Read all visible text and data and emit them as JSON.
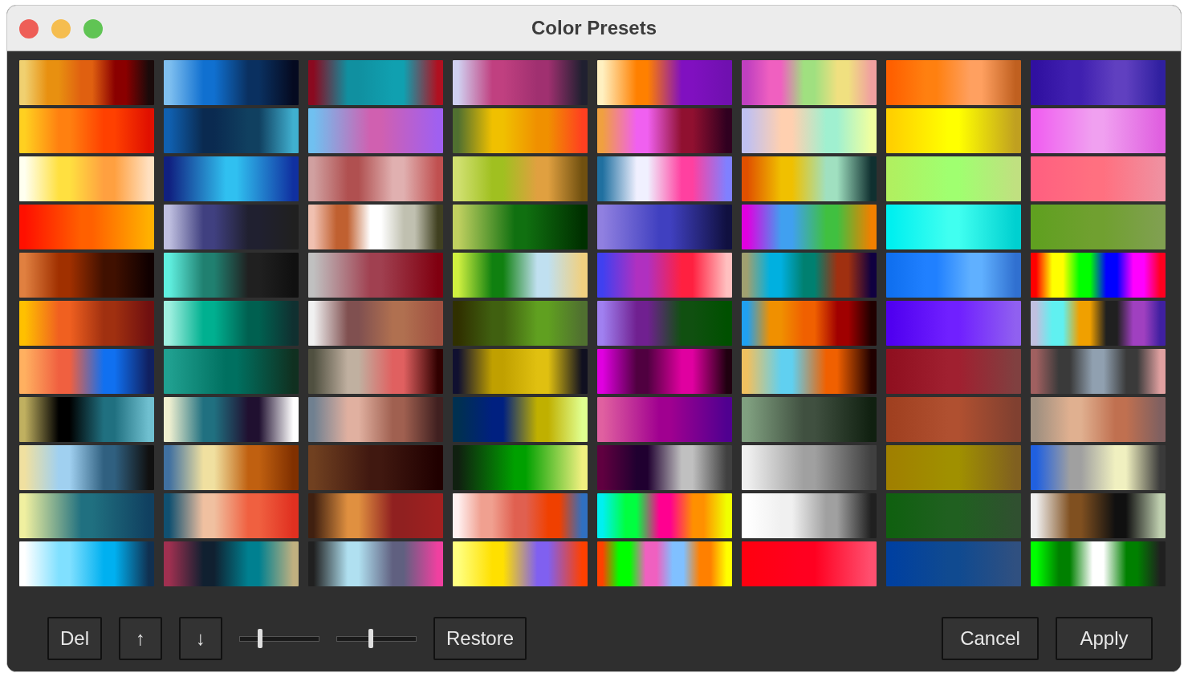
{
  "window": {
    "title": "Color Presets"
  },
  "swatches": [
    {
      "stops": [
        {
          "color": "#f0d070"
        },
        {
          "color": "#e89010"
        },
        {
          "color": "#e06010"
        },
        {
          "color": "#8a0000"
        },
        {
          "color": "#1a0a0a"
        }
      ]
    },
    {
      "stops": [
        {
          "color": "#80c0f0"
        },
        {
          "color": "#1070d0"
        },
        {
          "color": "#0a3060"
        },
        {
          "color": "#050a20"
        }
      ]
    },
    {
      "stops": [
        {
          "color": "#8a0a20"
        },
        {
          "color": "#1090a0"
        },
        {
          "color": "#10a0b0"
        },
        {
          "color": "#b01020"
        }
      ]
    },
    {
      "stops": [
        {
          "color": "#d0d0f0"
        },
        {
          "color": "#c04080"
        },
        {
          "color": "#a03070"
        },
        {
          "color": "#202030"
        }
      ]
    },
    {
      "stops": [
        {
          "color": "#fff0c0"
        },
        {
          "color": "#ff8000"
        },
        {
          "color": "#8010c0"
        },
        {
          "color": "#7010b0"
        }
      ]
    },
    {
      "stops": [
        {
          "color": "#c040c0"
        },
        {
          "color": "#f060c0"
        },
        {
          "color": "#a0e080"
        },
        {
          "color": "#f0e080"
        },
        {
          "color": "#f0a0a0"
        }
      ]
    },
    {
      "stops": [
        {
          "color": "#ff6000"
        },
        {
          "color": "#ff8010"
        },
        {
          "color": "#ffa060"
        },
        {
          "color": "#c06020"
        }
      ]
    },
    {
      "stops": [
        {
          "color": "#3010a0"
        },
        {
          "color": "#4020b0"
        },
        {
          "color": "#6040c0"
        },
        {
          "color": "#3020a0"
        }
      ]
    },
    {
      "stops": [
        {
          "color": "#ffd020"
        },
        {
          "color": "#ff8010"
        },
        {
          "color": "#ff4000"
        },
        {
          "color": "#e01000"
        }
      ]
    },
    {
      "stops": [
        {
          "color": "#1060b0"
        },
        {
          "color": "#0a2a50"
        },
        {
          "color": "#104060"
        },
        {
          "color": "#40b0d0"
        }
      ]
    },
    {
      "stops": [
        {
          "color": "#70c0f0"
        },
        {
          "color": "#d060b0"
        },
        {
          "color": "#a060f0"
        }
      ]
    },
    {
      "stops": [
        {
          "color": "#507030"
        },
        {
          "color": "#f0c000"
        },
        {
          "color": "#f09000"
        },
        {
          "color": "#ff4020"
        }
      ]
    },
    {
      "stops": [
        {
          "color": "#f0a040"
        },
        {
          "color": "#f060f0"
        },
        {
          "color": "#901030"
        },
        {
          "color": "#300020"
        }
      ]
    },
    {
      "stops": [
        {
          "color": "#c0c0f0"
        },
        {
          "color": "#ffd0b0"
        },
        {
          "color": "#a0f0d0"
        },
        {
          "color": "#f0ffa0"
        }
      ]
    },
    {
      "stops": [
        {
          "color": "#ffd000"
        },
        {
          "color": "#ffff00"
        },
        {
          "color": "#c0a020"
        }
      ]
    },
    {
      "stops": [
        {
          "color": "#f060f0"
        },
        {
          "color": "#f0a0f0"
        },
        {
          "color": "#e060e0"
        }
      ]
    },
    {
      "stops": [
        {
          "color": "#fffff0"
        },
        {
          "color": "#ffe040"
        },
        {
          "color": "#ffa040"
        },
        {
          "color": "#ffe0c0"
        }
      ]
    },
    {
      "stops": [
        {
          "color": "#102080"
        },
        {
          "color": "#30c0f0"
        },
        {
          "color": "#1030a0"
        }
      ]
    },
    {
      "stops": [
        {
          "color": "#d0a0a0"
        },
        {
          "color": "#b05050"
        },
        {
          "color": "#e0b0b0"
        },
        {
          "color": "#c05050"
        }
      ]
    },
    {
      "stops": [
        {
          "color": "#d0e070"
        },
        {
          "color": "#a0c020"
        },
        {
          "color": "#e0a040"
        },
        {
          "color": "#705010"
        }
      ]
    },
    {
      "stops": [
        {
          "color": "#2070a0"
        },
        {
          "color": "#f0f0ff"
        },
        {
          "color": "#ff40a0"
        },
        {
          "color": "#8080ff"
        }
      ]
    },
    {
      "stops": [
        {
          "color": "#e05000"
        },
        {
          "color": "#f0c000"
        },
        {
          "color": "#a0e0c0"
        },
        {
          "color": "#103030"
        }
      ]
    },
    {
      "stops": [
        {
          "color": "#b0f060"
        },
        {
          "color": "#a0ff70"
        },
        {
          "color": "#c0e080"
        }
      ]
    },
    {
      "stops": [
        {
          "color": "#ff6080"
        },
        {
          "color": "#ff7080"
        },
        {
          "color": "#f090a0"
        }
      ]
    },
    {
      "stops": [
        {
          "color": "#ff1000"
        },
        {
          "color": "#ff6000"
        },
        {
          "color": "#ffb000"
        }
      ]
    },
    {
      "stops": [
        {
          "color": "#c0c0e0"
        },
        {
          "color": "#404080"
        },
        {
          "color": "#202030"
        },
        {
          "color": "#202020"
        }
      ]
    },
    {
      "stops": [
        {
          "color": "#f0c0b0"
        },
        {
          "color": "#c06030"
        },
        {
          "color": "#ffffff"
        },
        {
          "color": "#c0c0b0"
        },
        {
          "color": "#404020"
        }
      ]
    },
    {
      "stops": [
        {
          "color": "#c0d060"
        },
        {
          "color": "#107010"
        },
        {
          "color": "#003000"
        }
      ]
    },
    {
      "stops": [
        {
          "color": "#9080e0"
        },
        {
          "color": "#4040c0"
        },
        {
          "color": "#101040"
        }
      ]
    },
    {
      "stops": [
        {
          "color": "#e000e0"
        },
        {
          "color": "#40a0f0"
        },
        {
          "color": "#40c040"
        },
        {
          "color": "#f08000"
        }
      ]
    },
    {
      "stops": [
        {
          "color": "#00f0f0"
        },
        {
          "color": "#40fff0"
        },
        {
          "color": "#00d0d0"
        }
      ]
    },
    {
      "stops": [
        {
          "color": "#60a020"
        },
        {
          "color": "#70a030"
        },
        {
          "color": "#80a050"
        }
      ]
    },
    {
      "stops": [
        {
          "color": "#e08040"
        },
        {
          "color": "#a03000"
        },
        {
          "color": "#401000"
        },
        {
          "color": "#100000"
        }
      ]
    },
    {
      "stops": [
        {
          "color": "#60f0e0"
        },
        {
          "color": "#208070"
        },
        {
          "color": "#202020"
        },
        {
          "color": "#101010"
        }
      ]
    },
    {
      "stops": [
        {
          "color": "#c0c0c0"
        },
        {
          "color": "#a04050"
        },
        {
          "color": "#800010"
        }
      ]
    },
    {
      "stops": [
        {
          "color": "#d0f040"
        },
        {
          "color": "#108010"
        },
        {
          "color": "#c0e0f0"
        },
        {
          "color": "#f0d080"
        }
      ]
    },
    {
      "stops": [
        {
          "color": "#4040f0"
        },
        {
          "color": "#b030c0"
        },
        {
          "color": "#ff2040"
        },
        {
          "color": "#ffc0c0"
        }
      ]
    },
    {
      "stops": [
        {
          "color": "#a0a070"
        },
        {
          "color": "#00b0e0"
        },
        {
          "color": "#008070"
        },
        {
          "color": "#a03010"
        },
        {
          "color": "#100040"
        }
      ]
    },
    {
      "stops": [
        {
          "color": "#1070f0"
        },
        {
          "color": "#2080ff"
        },
        {
          "color": "#60b0ff"
        },
        {
          "color": "#3070d0"
        }
      ]
    },
    {
      "stops": [
        {
          "color": "#ff0000"
        },
        {
          "color": "#ffff00"
        },
        {
          "color": "#00ff00"
        },
        {
          "color": "#0000ff"
        },
        {
          "color": "#ff00ff"
        },
        {
          "color": "#ff0020"
        }
      ]
    },
    {
      "stops": [
        {
          "color": "#ffc000"
        },
        {
          "color": "#f06020"
        },
        {
          "color": "#a03010"
        },
        {
          "color": "#701010"
        }
      ]
    },
    {
      "stops": [
        {
          "color": "#a0f0e0"
        },
        {
          "color": "#00b090"
        },
        {
          "color": "#006050"
        },
        {
          "color": "#103030"
        }
      ]
    },
    {
      "stops": [
        {
          "color": "#f0f0f0"
        },
        {
          "color": "#805050"
        },
        {
          "color": "#b07050"
        },
        {
          "color": "#a05040"
        }
      ]
    },
    {
      "stops": [
        {
          "color": "#303000"
        },
        {
          "color": "#406010"
        },
        {
          "color": "#60a020"
        },
        {
          "color": "#507030"
        }
      ]
    },
    {
      "stops": [
        {
          "color": "#a080f0"
        },
        {
          "color": "#702090"
        },
        {
          "color": "#105010"
        },
        {
          "color": "#005000"
        }
      ]
    },
    {
      "stops": [
        {
          "color": "#20a0f0"
        },
        {
          "color": "#f09000"
        },
        {
          "color": "#f06000"
        },
        {
          "color": "#a00000"
        },
        {
          "color": "#200000"
        }
      ]
    },
    {
      "stops": [
        {
          "color": "#5000f0"
        },
        {
          "color": "#7020ff"
        },
        {
          "color": "#9060f0"
        }
      ]
    },
    {
      "stops": [
        {
          "color": "#c0c0e0"
        },
        {
          "color": "#60f0f0"
        },
        {
          "color": "#f0a000"
        },
        {
          "color": "#202020"
        },
        {
          "color": "#a040c0"
        },
        {
          "color": "#4020a0"
        }
      ]
    },
    {
      "stops": [
        {
          "color": "#ffb060"
        },
        {
          "color": "#f06040"
        },
        {
          "color": "#1070f0"
        },
        {
          "color": "#102060"
        }
      ]
    },
    {
      "stops": [
        {
          "color": "#20a090"
        },
        {
          "color": "#007060"
        },
        {
          "color": "#103020"
        }
      ]
    },
    {
      "stops": [
        {
          "color": "#505040"
        },
        {
          "color": "#c0b0a0"
        },
        {
          "color": "#e06060"
        },
        {
          "color": "#300000"
        }
      ]
    },
    {
      "stops": [
        {
          "color": "#101030"
        },
        {
          "color": "#c0a000"
        },
        {
          "color": "#e0c010"
        },
        {
          "color": "#101020"
        }
      ]
    },
    {
      "stops": [
        {
          "color": "#e000e0"
        },
        {
          "color": "#500040"
        },
        {
          "color": "#e000a0"
        },
        {
          "color": "#200010"
        }
      ]
    },
    {
      "stops": [
        {
          "color": "#f0c060"
        },
        {
          "color": "#60d0f0"
        },
        {
          "color": "#f06000"
        },
        {
          "color": "#200000"
        }
      ]
    },
    {
      "stops": [
        {
          "color": "#901020"
        },
        {
          "color": "#a02030"
        },
        {
          "color": "#804040"
        }
      ]
    },
    {
      "stops": [
        {
          "color": "#a06060"
        },
        {
          "color": "#3a3a3a"
        },
        {
          "color": "#90a0b0"
        },
        {
          "color": "#3a3a3a"
        },
        {
          "color": "#e0a0a0"
        }
      ]
    },
    {
      "stops": [
        {
          "color": "#c0b060"
        },
        {
          "color": "#000000"
        },
        {
          "color": "#207080"
        },
        {
          "color": "#70c0d0"
        }
      ]
    },
    {
      "stops": [
        {
          "color": "#f0f0d0"
        },
        {
          "color": "#207080"
        },
        {
          "color": "#201030"
        },
        {
          "color": "#ffffff"
        }
      ]
    },
    {
      "stops": [
        {
          "color": "#708090"
        },
        {
          "color": "#e0b0a0"
        },
        {
          "color": "#a06050"
        },
        {
          "color": "#402020"
        }
      ]
    },
    {
      "stops": [
        {
          "color": "#003050"
        },
        {
          "color": "#002080"
        },
        {
          "color": "#c0b000"
        },
        {
          "color": "#e0ff90"
        }
      ]
    },
    {
      "stops": [
        {
          "color": "#e060a0"
        },
        {
          "color": "#a00090"
        },
        {
          "color": "#500090"
        }
      ]
    },
    {
      "stops": [
        {
          "color": "#80a080"
        },
        {
          "color": "#405040"
        },
        {
          "color": "#102010"
        }
      ]
    },
    {
      "stops": [
        {
          "color": "#a04020"
        },
        {
          "color": "#b05030"
        },
        {
          "color": "#804030"
        }
      ]
    },
    {
      "stops": [
        {
          "color": "#a09080"
        },
        {
          "color": "#e0b090"
        },
        {
          "color": "#c07050"
        },
        {
          "color": "#806060"
        }
      ]
    },
    {
      "stops": [
        {
          "color": "#f0e0a0"
        },
        {
          "color": "#a0d0f0"
        },
        {
          "color": "#306080"
        },
        {
          "color": "#101010"
        }
      ]
    },
    {
      "stops": [
        {
          "color": "#4070a0"
        },
        {
          "color": "#f0e0a0"
        },
        {
          "color": "#c06010"
        },
        {
          "color": "#803000"
        }
      ]
    },
    {
      "stops": [
        {
          "color": "#704020"
        },
        {
          "color": "#401810"
        },
        {
          "color": "#200000"
        }
      ]
    },
    {
      "stops": [
        {
          "color": "#102010"
        },
        {
          "color": "#00a000"
        },
        {
          "color": "#f0f080"
        }
      ]
    },
    {
      "stops": [
        {
          "color": "#600040"
        },
        {
          "color": "#200030"
        },
        {
          "color": "#c0c0c0"
        },
        {
          "color": "#404040"
        }
      ]
    },
    {
      "stops": [
        {
          "color": "#f0f0f0"
        },
        {
          "color": "#a0a0a0"
        },
        {
          "color": "#404040"
        }
      ]
    },
    {
      "stops": [
        {
          "color": "#a08000"
        },
        {
          "color": "#a09000"
        },
        {
          "color": "#806020"
        }
      ]
    },
    {
      "stops": [
        {
          "color": "#2060e0"
        },
        {
          "color": "#a0a0a0"
        },
        {
          "color": "#f0f0c0"
        },
        {
          "color": "#3a3a3a"
        }
      ]
    },
    {
      "stops": [
        {
          "color": "#f0f0a0"
        },
        {
          "color": "#207080"
        },
        {
          "color": "#104060"
        }
      ]
    },
    {
      "stops": [
        {
          "color": "#105070"
        },
        {
          "color": "#f0c0a0"
        },
        {
          "color": "#f06040"
        },
        {
          "color": "#e03020"
        }
      ]
    },
    {
      "stops": [
        {
          "color": "#402010"
        },
        {
          "color": "#e09040"
        },
        {
          "color": "#902020"
        },
        {
          "color": "#a02020"
        }
      ]
    },
    {
      "stops": [
        {
          "color": "#fff0f0"
        },
        {
          "color": "#f0a090"
        },
        {
          "color": "#e06050"
        },
        {
          "color": "#f04000"
        },
        {
          "color": "#3070c0"
        }
      ]
    },
    {
      "stops": [
        {
          "color": "#00f0f0"
        },
        {
          "color": "#00ff40"
        },
        {
          "color": "#ff0090"
        },
        {
          "color": "#ff9000"
        },
        {
          "color": "#f0ff00"
        }
      ]
    },
    {
      "stops": [
        {
          "color": "#ffffff"
        },
        {
          "color": "#f0f0f0"
        },
        {
          "color": "#a0a0a0"
        },
        {
          "color": "#202020"
        }
      ]
    },
    {
      "stops": [
        {
          "color": "#106010"
        },
        {
          "color": "#206020"
        },
        {
          "color": "#305030"
        }
      ]
    },
    {
      "stops": [
        {
          "color": "#f0f0f0"
        },
        {
          "color": "#805020"
        },
        {
          "color": "#101010"
        },
        {
          "color": "#c0d0b0"
        }
      ]
    },
    {
      "stops": [
        {
          "color": "#ffffff"
        },
        {
          "color": "#80e0ff"
        },
        {
          "color": "#00b0f0"
        },
        {
          "color": "#103050"
        }
      ]
    },
    {
      "stops": [
        {
          "color": "#a03050"
        },
        {
          "color": "#102030"
        },
        {
          "color": "#008090"
        },
        {
          "color": "#c0b080"
        }
      ]
    },
    {
      "stops": [
        {
          "color": "#202020"
        },
        {
          "color": "#b0e0f0"
        },
        {
          "color": "#606080"
        },
        {
          "color": "#f040a0"
        }
      ]
    },
    {
      "stops": [
        {
          "color": "#ffff80"
        },
        {
          "color": "#ffe000"
        },
        {
          "color": "#8060f0"
        },
        {
          "color": "#ff4000"
        }
      ]
    },
    {
      "stops": [
        {
          "color": "#ff4000"
        },
        {
          "color": "#00ff00"
        },
        {
          "color": "#f060c0"
        },
        {
          "color": "#80c0ff"
        },
        {
          "color": "#ff8000"
        },
        {
          "color": "#ffff00"
        }
      ]
    },
    {
      "stops": [
        {
          "color": "#ff0010"
        },
        {
          "color": "#ff0020"
        },
        {
          "color": "#ff5070"
        }
      ]
    },
    {
      "stops": [
        {
          "color": "#0040a0"
        },
        {
          "color": "#104a90"
        },
        {
          "color": "#305080"
        }
      ]
    },
    {
      "stops": [
        {
          "color": "#00ff00"
        },
        {
          "color": "#008000"
        },
        {
          "color": "#ffffff"
        },
        {
          "color": "#008000"
        },
        {
          "color": "#202020"
        }
      ]
    }
  ],
  "controls": [
    {
      "kind": "button",
      "label": "Del"
    },
    {
      "kind": "button",
      "label": "↑"
    },
    {
      "kind": "button",
      "label": "↓"
    },
    {
      "kind": "slider",
      "level": 0.25
    },
    {
      "kind": "slider",
      "level": 0.43
    },
    {
      "kind": "button",
      "label": "Restore"
    }
  ],
  "actions": [
    {
      "label": "Cancel"
    },
    {
      "label": "Apply"
    }
  ]
}
